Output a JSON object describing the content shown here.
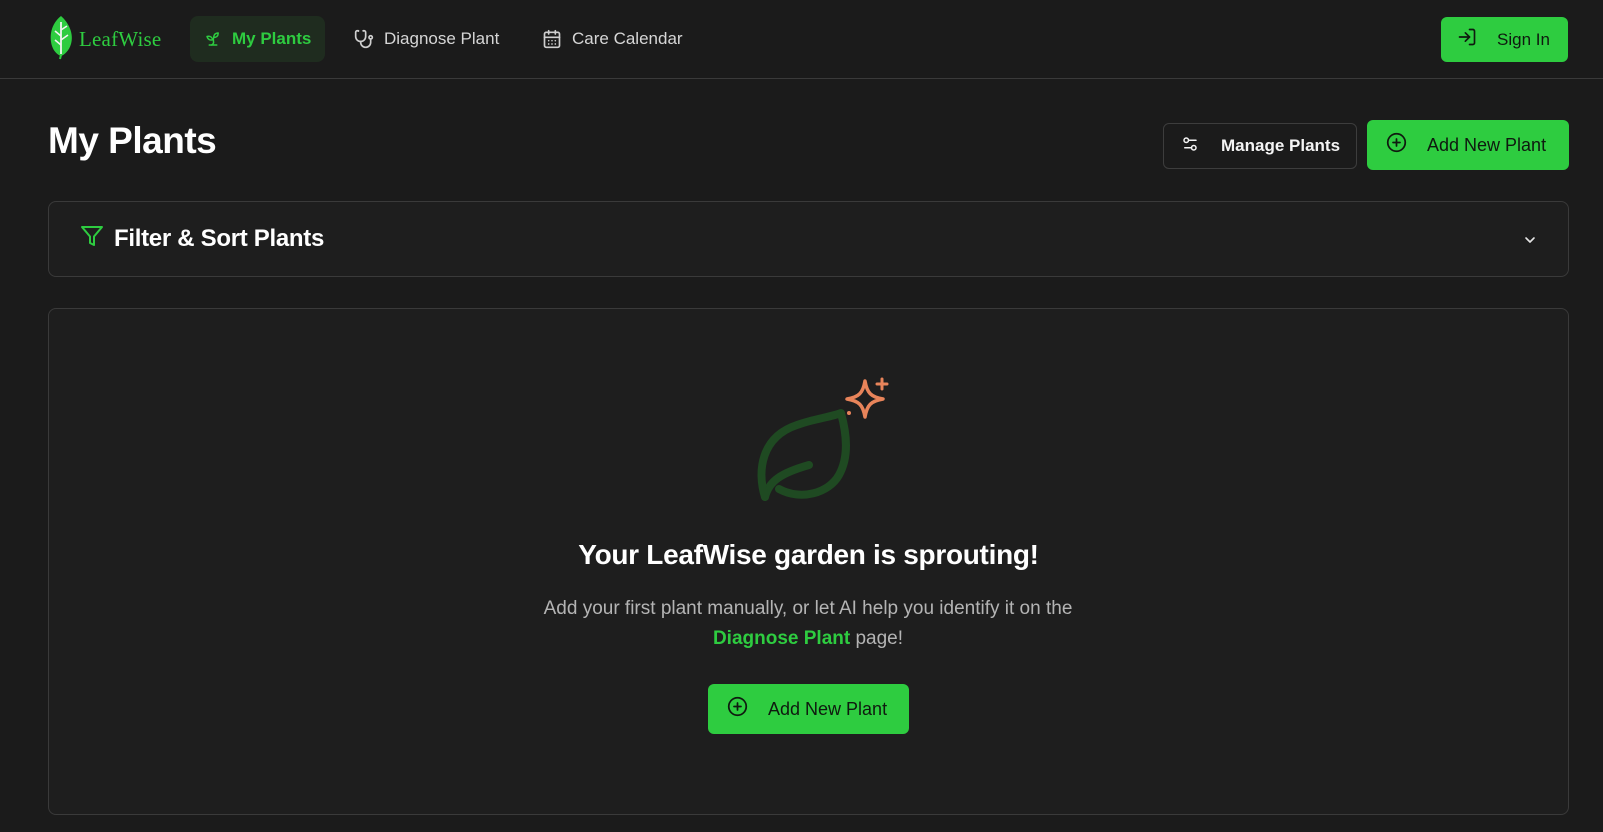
{
  "brand": {
    "name": "LeafWise",
    "accent": "#2ecc40",
    "background": "#1b1b1b"
  },
  "nav": {
    "items": [
      {
        "label": "My Plants",
        "icon": "sprout-icon",
        "active": true
      },
      {
        "label": "Diagnose Plant",
        "icon": "stethoscope-icon",
        "active": false
      },
      {
        "label": "Care Calendar",
        "icon": "calendar-icon",
        "active": false
      }
    ],
    "sign_in": {
      "label": "Sign In",
      "icon": "log-in-icon"
    }
  },
  "page": {
    "title": "My Plants",
    "manage_button": {
      "label": "Manage Plants",
      "icon": "sliders-icon"
    },
    "add_button": {
      "label": "Add New Plant",
      "icon": "plus-circle-icon"
    }
  },
  "filter": {
    "title": "Filter & Sort Plants",
    "icon": "filter-icon",
    "expanded": false
  },
  "empty_state": {
    "icon": "leaf-sparkle-icon",
    "title": "Your LeafWise garden is sprouting!",
    "desc_before": "Add your first plant manually, or let AI help you identify it on the",
    "link_text": "Diagnose Plant",
    "desc_after": "page!",
    "button": {
      "label": "Add New Plant",
      "icon": "plus-circle-icon"
    }
  }
}
